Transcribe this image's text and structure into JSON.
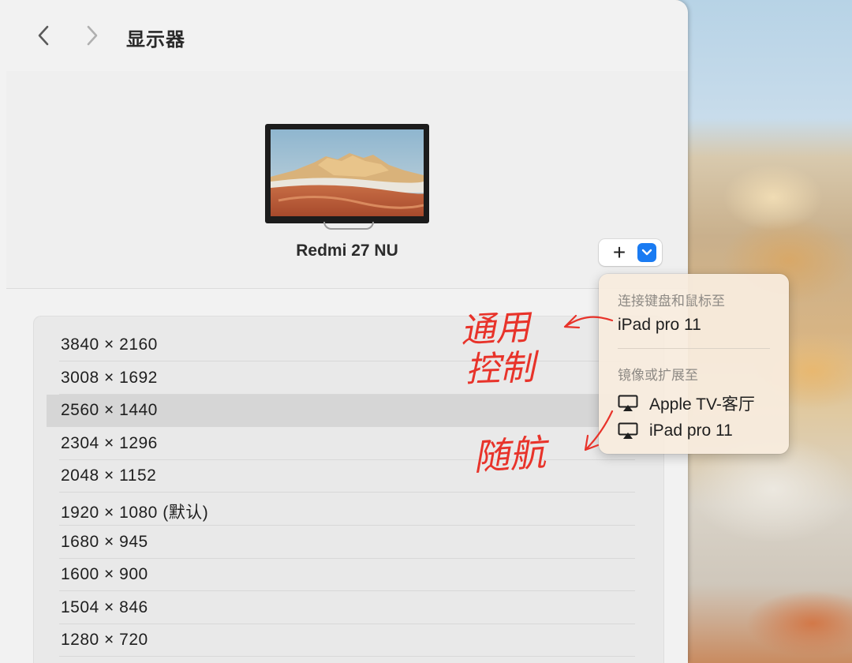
{
  "window": {
    "title": "显示器"
  },
  "toolbar": {
    "back_icon": "chevron-left-icon",
    "forward_icon": "chevron-right-icon"
  },
  "display": {
    "name": "Redmi 27 NU",
    "add_label": "+",
    "dropdown_icon": "chevron-down-icon"
  },
  "resolutions": [
    {
      "label": "3840 × 2160",
      "selected": false
    },
    {
      "label": "3008 × 1692",
      "selected": false
    },
    {
      "label": "2560 × 1440",
      "selected": true
    },
    {
      "label": "2304 × 1296",
      "selected": false
    },
    {
      "label": "2048 × 1152",
      "selected": false
    },
    {
      "label": "1920 × 1080 (默认)",
      "selected": false
    },
    {
      "label": "1680 × 945",
      "selected": false
    },
    {
      "label": "1600 × 900",
      "selected": false
    },
    {
      "label": "1504 × 846",
      "selected": false
    },
    {
      "label": "1280 × 720",
      "selected": false
    }
  ],
  "popup": {
    "section1_header": "连接键盘和鼠标至",
    "section1_item": "iPad pro 11",
    "section2_header": "镜像或扩展至",
    "section2_items": [
      {
        "label": "Apple TV-客厅",
        "icon": "airplay-icon"
      },
      {
        "label": "iPad pro 11",
        "icon": "airplay-icon"
      }
    ]
  },
  "annotations": {
    "note1_line1": "通用",
    "note1_line2": "控制",
    "note2": "随航",
    "ink_color": "#e8332a"
  },
  "colors": {
    "accent": "#1a7bf2",
    "window_bg": "#f2f2f2",
    "selected_row": "#d6d6d6"
  }
}
